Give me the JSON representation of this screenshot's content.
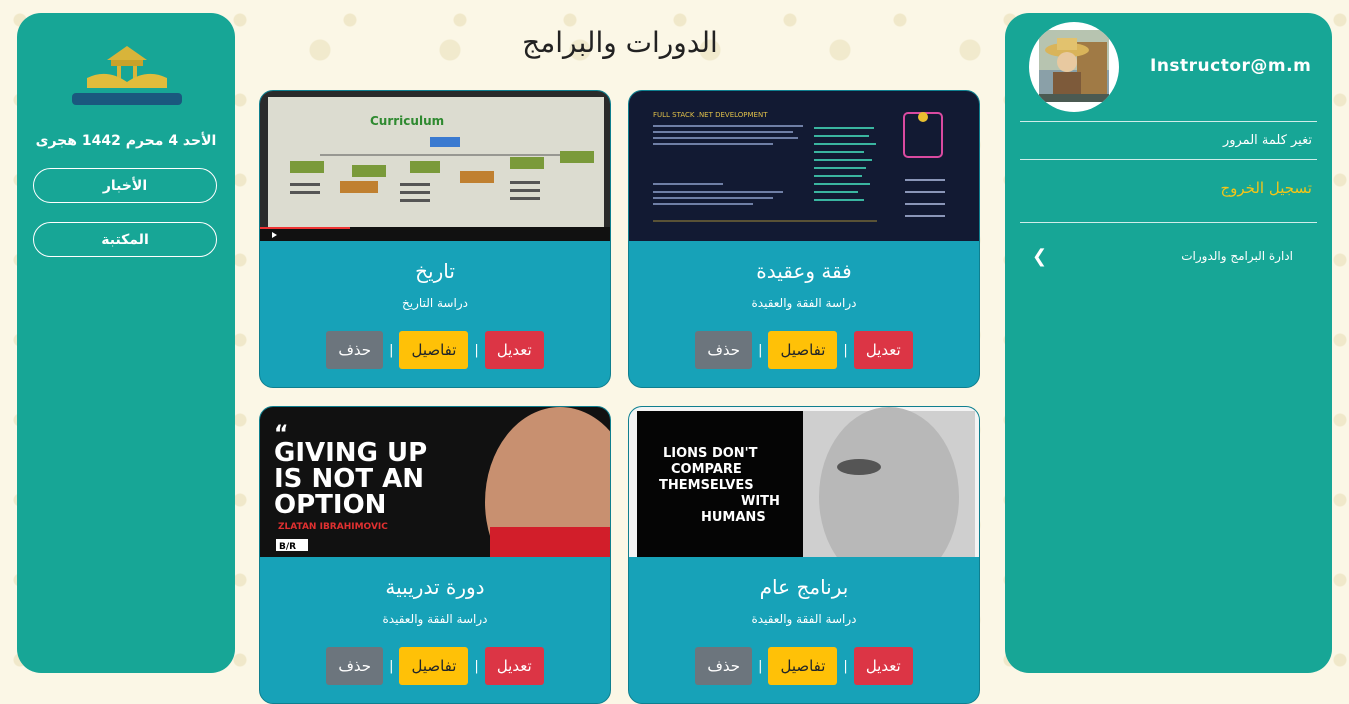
{
  "user": {
    "email": "Instructor@m.m"
  },
  "right_menu": {
    "change_password": "تغير كلمة المرور",
    "logout": "تسجيل الخروج",
    "manage_programs": "ادارة البرامج والدورات"
  },
  "left_menu": {
    "date": "الأحد 4 محرم 1442 هجرى",
    "news": "الأخبار",
    "library": "المكتبة"
  },
  "page": {
    "title": "الدورات والبرامج"
  },
  "actions": {
    "edit": "تعديل",
    "details": "تفاصيل",
    "delete": "حذف",
    "separator": "|"
  },
  "courses": [
    {
      "title": "فقة وعقيدة",
      "description": "دراسة الفقة والعقيدة",
      "thumb_heading": "FULL STACK .NET DEVELOPMENT"
    },
    {
      "title": "تاريخ",
      "description": "دراسة التاريخ",
      "thumb_heading": "Curriculum"
    },
    {
      "title": "برنامج عام",
      "description": "دراسة الفقة والعقيدة",
      "thumb_lines": [
        "LIONS DON'T",
        "COMPARE",
        "THEMSELVES",
        "WITH",
        "HUMANS"
      ]
    },
    {
      "title": "دورة تدريبية",
      "description": "دراسة الفقة والعقيدة",
      "thumb_lines": [
        "GIVING UP",
        "IS NOT AN",
        "OPTION"
      ],
      "thumb_name": "ZLATAN IBRAHIMOVIC",
      "thumb_badge": "B/R"
    }
  ],
  "colors": {
    "panel": "#17a696",
    "card": "#17a2b8",
    "edit": "#dc3545",
    "details": "#ffc107",
    "delete": "#6c757d",
    "logout": "#f5c518"
  }
}
